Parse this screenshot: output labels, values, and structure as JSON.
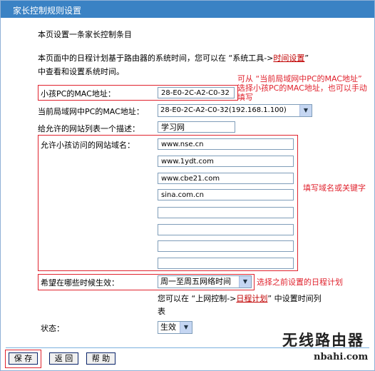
{
  "window_title": "家长控制规则设置",
  "intro": "本页设置一条家长控制条目",
  "desc_line1_pre": "本页面中的日程计划基于路由器的系统时间，您可以在 “系统工具->",
  "desc_link": "时间设置",
  "desc_line1_post": "”",
  "desc_line2": "中查看和设置系统时间。",
  "child_mac_label": "小孩PC的MAC地址：",
  "child_mac_value": "28-E0-2C-A2-C0-32",
  "lan_mac_label": "当前局域网中PC的MAC地址：",
  "lan_mac_selected": "28-E0-2C-A2-C0-32(192.168.1.100)",
  "desc_label": "给允许的网站列表一个描述：",
  "desc_value": "学习网",
  "domains_label": "允许小孩访问的网站域名：",
  "domains": [
    "www.nse.cn",
    "www.1ydt.com",
    "www.cbe21.com",
    "sina.com.cn",
    "",
    "",
    "",
    ""
  ],
  "schedule_label": "希望在哪些时候生效：",
  "schedule_selected": "周一至周五网络时间",
  "schedule_hint_pre": "您可以在 “上网控制->",
  "schedule_hint_link": "日程计划",
  "schedule_hint_post": "” 中设置时间列",
  "schedule_hint_line2": "表",
  "status_label": "状态：",
  "status_selected": "生效",
  "annotations": {
    "mac_note_line1": "可从 “当前局域网中PC的MAC地址”",
    "mac_note_line2": "选择小孩PC的MAC地址，也可以手动",
    "mac_note_line3": "填写",
    "domain_note": "填写域名或关键字",
    "schedule_note": "选择之前设置的日程计划"
  },
  "buttons": {
    "save": "保 存",
    "back": "返 回",
    "help": "帮 助"
  },
  "watermark": {
    "line1": "无线路由器",
    "line2": "nbahi.com"
  },
  "colors": {
    "titlebar": "#3a82c4",
    "annotation": "#e0232e",
    "link": "#c00000"
  }
}
